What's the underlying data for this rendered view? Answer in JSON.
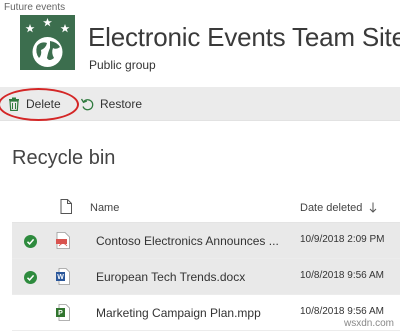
{
  "breadcrumb": "Future events",
  "site": {
    "title": "Electronic Events Team Site",
    "subtitle": "Public group"
  },
  "toolbar": {
    "delete_label": "Delete",
    "restore_label": "Restore"
  },
  "page_title": "Recycle bin",
  "table": {
    "col_name": "Name",
    "col_date": "Date deleted",
    "rows": [
      {
        "name": "Contoso Electronics Announces ...",
        "date": "10/9/2018 2:09 PM",
        "selected": true,
        "file_icon": "pdf-icon"
      },
      {
        "name": "European Tech Trends.docx",
        "date": "10/8/2018 9:56 AM",
        "selected": true,
        "file_icon": "word-doc-icon"
      },
      {
        "name": "Marketing Campaign Plan.mpp",
        "date": "10/8/2018 9:56 AM",
        "selected": false,
        "file_icon": "project-file-icon"
      }
    ]
  },
  "watermark": "wsxdn.com",
  "colors": {
    "logo_bg": "#3c6e4e",
    "check_green": "#2e8b3e",
    "annotation_red": "#d42626",
    "toolbar_bg": "#ebebeb"
  }
}
